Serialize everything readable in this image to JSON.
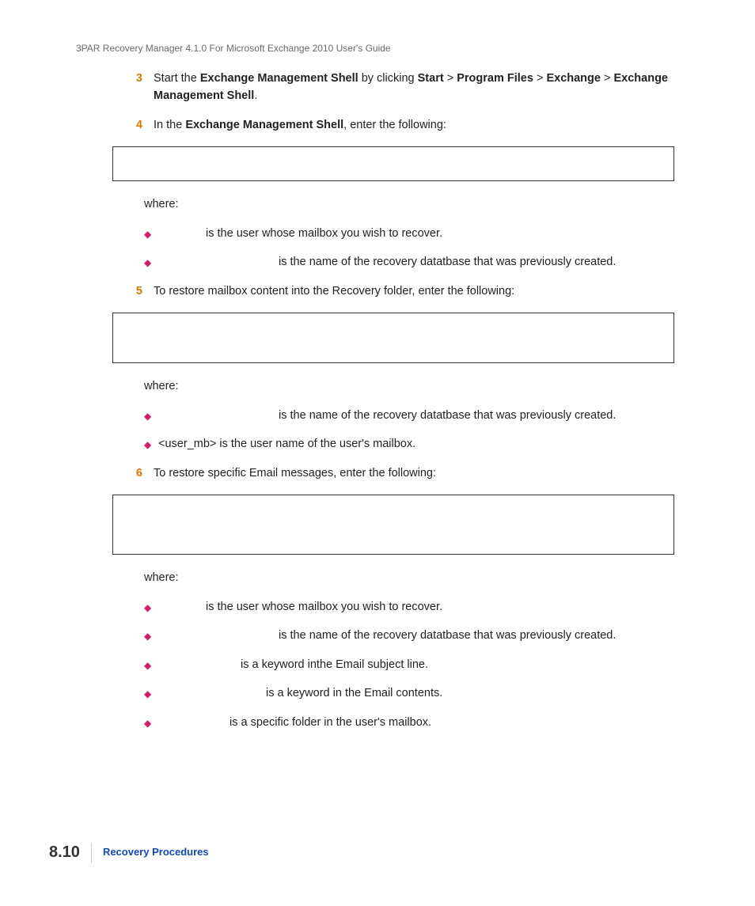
{
  "running_head": "3PAR Recovery Manager 4.1.0 For Microsoft Exchange 2010 User's Guide",
  "steps": {
    "s3": {
      "num": "3",
      "pre": "Start the ",
      "b1": "Exchange Management Shell",
      "mid1": " by clicking ",
      "b2": "Start",
      "gt1": " > ",
      "b3": "Program Files",
      "gt2": " > ",
      "b4": "Exchange",
      "gt3": " > ",
      "b5": "Exchange Management Shell",
      "end": "."
    },
    "s4": {
      "num": "4",
      "pre": "In the ",
      "b1": "Exchange Management Shell",
      "post": ", enter the following:",
      "where": "where:",
      "bul1": " is the user whose mailbox you wish to recover.",
      "bul2": " is the name of the recovery datatbase that was previously created."
    },
    "s5": {
      "num": "5",
      "body": "To restore mailbox content into the Recovery folder, enter the following:",
      "where": "where:",
      "bul1": " is the name of the recovery datatbase that was previously created.",
      "bul2": "<user_mb> is the user name of the user's mailbox."
    },
    "s6": {
      "num": "6",
      "body": "To restore specific Email messages, enter the following:",
      "where": "where:",
      "bul1": " is the user whose mailbox you wish to recover.",
      "bul2": " is the name of the recovery datatbase that was previously created.",
      "bul3": " is a keyword inthe Email subject line.",
      "bul4": " is a keyword in the Email contents.",
      "bul5": " is a specific folder in the user's mailbox."
    }
  },
  "footer": {
    "page": "8.10",
    "chapter": "Recovery Procedures"
  }
}
